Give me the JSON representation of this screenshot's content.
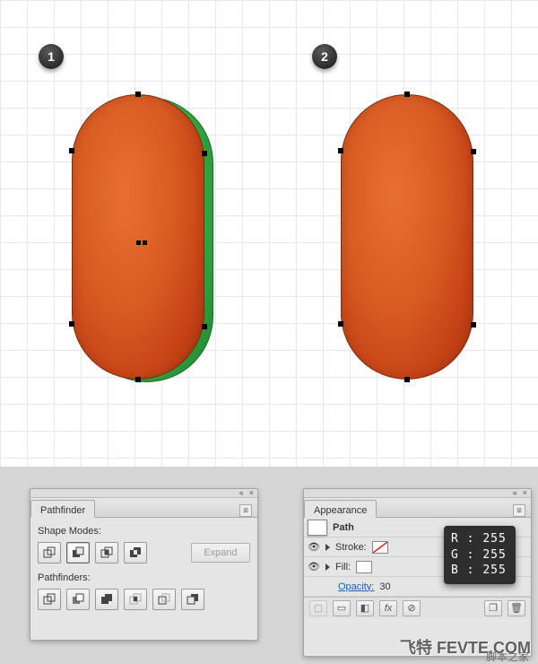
{
  "steps": {
    "badge1": "1",
    "badge2": "2"
  },
  "pathfinder": {
    "tab": "Pathfinder",
    "shape_modes_label": "Shape Modes:",
    "pathfinders_label": "Pathfinders:",
    "expand_label": "Expand",
    "modes": [
      "unite",
      "minus-front",
      "intersect",
      "exclude"
    ],
    "active_mode": "minus-front",
    "operations": [
      "divide",
      "trim",
      "merge",
      "crop",
      "outline",
      "minus-back"
    ]
  },
  "appearance": {
    "tab": "Appearance",
    "target_label": "Path",
    "stroke_label": "Stroke:",
    "fill_label": "Fill:",
    "opacity_label": "Opacity:",
    "opacity_value": "30",
    "fx_label": "fx"
  },
  "rgb_tooltip": {
    "r_label": "R :",
    "g_label": "G :",
    "b_label": "B :",
    "r": "255",
    "g": "255",
    "b": "255"
  },
  "watermark": {
    "main": "飞特 FEVTE.COM",
    "sub": "脚本之家"
  }
}
